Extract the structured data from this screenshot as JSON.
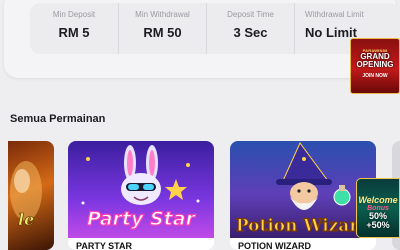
{
  "stats": [
    {
      "label": "Min Deposit",
      "value": "RM 5"
    },
    {
      "label": "Min Withdrawal",
      "value": "RM 50"
    },
    {
      "label": "Deposit Time",
      "value": "3 Sec"
    },
    {
      "label": "Withdrawal Limit",
      "value": "No Limit"
    }
  ],
  "promo_top": {
    "line1": "PARAWIN88",
    "line2": "GRAND",
    "line3": "OPENING",
    "cta": "JOIN NOW"
  },
  "games_section": {
    "title": "Semua Permainan",
    "games": [
      {
        "name": "PARTY STAR",
        "art_text": "Party Star"
      },
      {
        "name": "POTION WIZARD",
        "art_text": "Potion Wizard"
      }
    ],
    "left_tile_art_text": "le"
  },
  "promo_welcome": {
    "line1": "Welcome",
    "line2": "Bonus",
    "line3a": "50%",
    "line3b": "+50%"
  },
  "colors": {
    "background": "#eeeef0",
    "card": "#f4f4f6",
    "promo_red": "#c21a1a",
    "party_purple": "#6b2fd6",
    "potion_orange": "#e7832a"
  }
}
